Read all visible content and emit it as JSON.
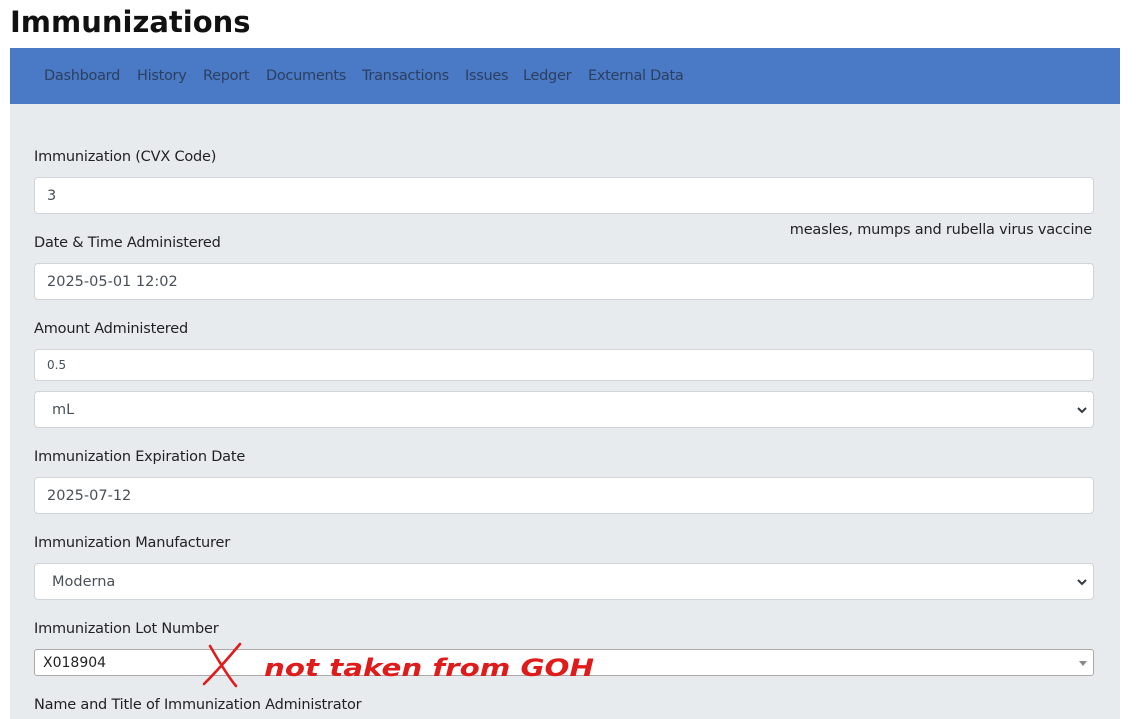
{
  "page": {
    "title": "Immunizations"
  },
  "nav": {
    "items": [
      "Dashboard",
      "History",
      "Report",
      "Documents",
      "Transactions",
      "Issues",
      "Ledger",
      "External Data"
    ]
  },
  "form": {
    "cvx": {
      "label": "Immunization (CVX Code)",
      "value": "3",
      "description": "measles, mumps and rubella virus vaccine"
    },
    "date": {
      "label": "Date & Time Administered",
      "value": "2025-05-01 12:02"
    },
    "amount": {
      "label": "Amount Administered",
      "value": "0.5",
      "unit": "mL"
    },
    "expiration": {
      "label": "Immunization Expiration Date",
      "value": "2025-07-12"
    },
    "manufacturer": {
      "label": "Immunization Manufacturer",
      "value": "Moderna"
    },
    "lot": {
      "label": "Immunization Lot Number",
      "value": "X018904"
    },
    "administrator": {
      "label": "Name and Title of Immunization Administrator"
    }
  },
  "annotation": {
    "text": "not taken from GOH",
    "color": "#e01b1b"
  },
  "colors": {
    "navbar": "#4a7ac5",
    "nav_text": "#2b3f61",
    "content_bg": "#e8ebee"
  }
}
